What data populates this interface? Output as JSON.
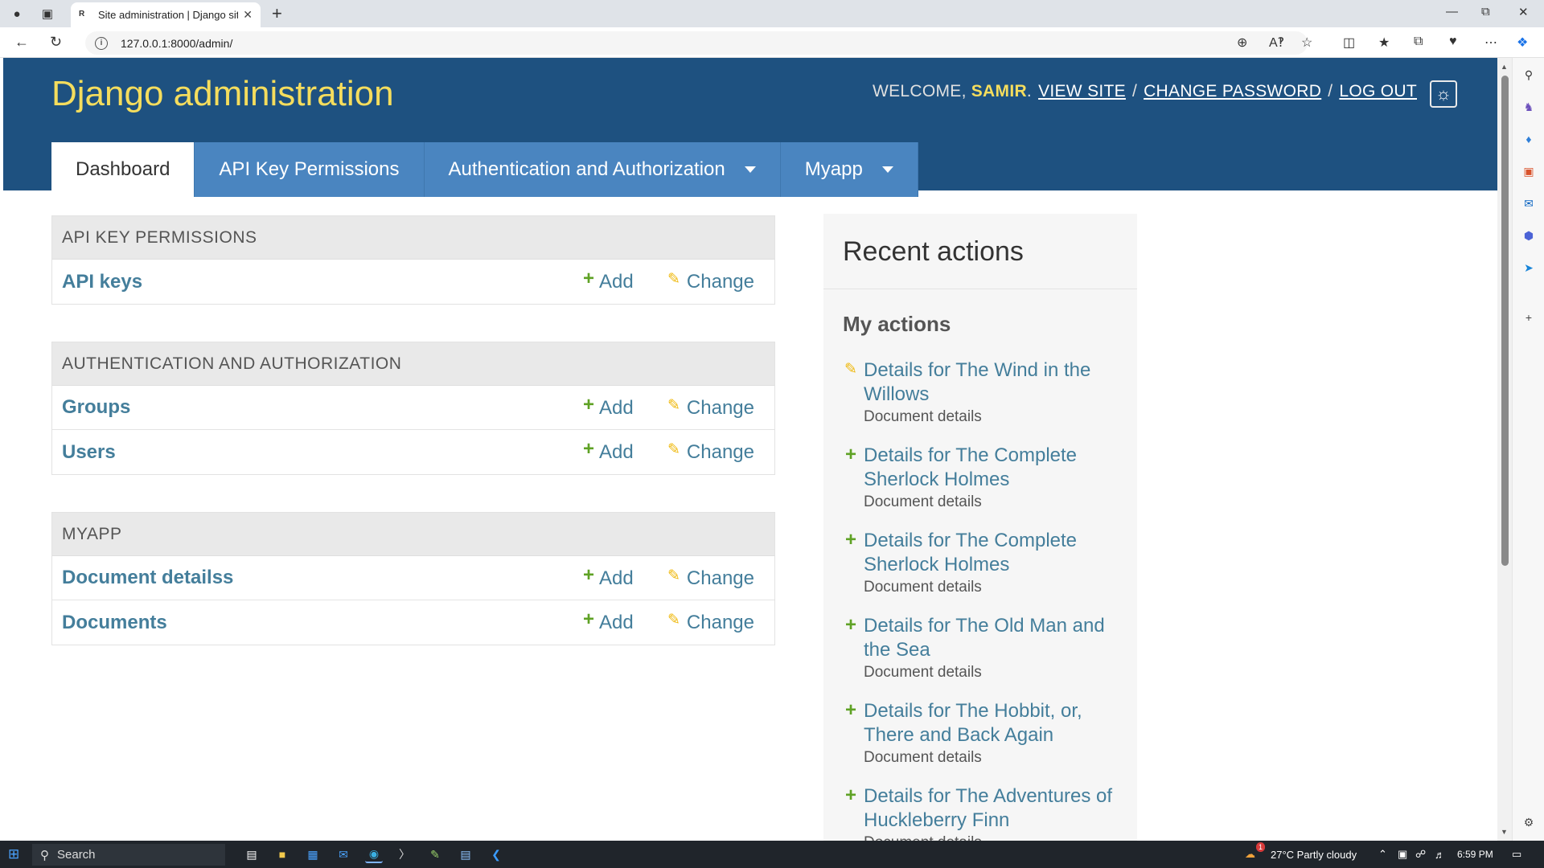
{
  "browser": {
    "tab_title": "Site administration | Django site a",
    "tab_favicon": "R",
    "url": "127.0.0.1:8000/admin/",
    "new_tab": "+"
  },
  "header": {
    "branding": "Django administration",
    "welcome": "WELCOME,",
    "username": "SAMIR",
    "period": ".",
    "view_site": "VIEW SITE",
    "change_password": "CHANGE PASSWORD",
    "log_out": "LOG OUT",
    "separator": "/"
  },
  "nav": {
    "tabs": [
      {
        "label": "Dashboard"
      },
      {
        "label": "API Key Permissions"
      },
      {
        "label": "Authentication and Authorization"
      },
      {
        "label": "Myapp"
      }
    ]
  },
  "modules": [
    {
      "caption": "API KEY PERMISSIONS",
      "rows": [
        {
          "model": "API keys",
          "add": "Add",
          "change": "Change"
        }
      ]
    },
    {
      "caption": "AUTHENTICATION AND AUTHORIZATION",
      "rows": [
        {
          "model": "Groups",
          "add": "Add",
          "change": "Change"
        },
        {
          "model": "Users",
          "add": "Add",
          "change": "Change"
        }
      ]
    },
    {
      "caption": "MYAPP",
      "rows": [
        {
          "model": "Document detailss",
          "add": "Add",
          "change": "Change"
        },
        {
          "model": "Documents",
          "add": "Add",
          "change": "Change"
        }
      ]
    }
  ],
  "recent": {
    "title": "Recent actions",
    "subtitle": "My actions",
    "items": [
      {
        "icon": "pencil-icon",
        "title": "Details for The Wind in the Willows",
        "type": "Document details"
      },
      {
        "icon": "plus-icon",
        "title": "Details for The Complete Sherlock Holmes",
        "type": "Document details"
      },
      {
        "icon": "plus-icon",
        "title": "Details for The Complete Sherlock Holmes",
        "type": "Document details"
      },
      {
        "icon": "plus-icon",
        "title": "Details for The Old Man and the Sea",
        "type": "Document details"
      },
      {
        "icon": "plus-icon",
        "title": "Details for The Hobbit, or, There and Back Again",
        "type": "Document details"
      },
      {
        "icon": "plus-icon",
        "title": "Details for The Adventures of Huckleberry Finn",
        "type": "Document details"
      }
    ]
  },
  "taskbar": {
    "search": "Search",
    "weather": "27°C  Partly cloudy",
    "time": "6:59 PM",
    "weather_badge": "1"
  },
  "colors": {
    "header_bg": "#1e5180",
    "branding": "#f5dd5d",
    "nav_tab": "#4a85c0",
    "link": "#447e9b",
    "add_icon": "#5fa225",
    "change_icon": "#efb80b"
  }
}
